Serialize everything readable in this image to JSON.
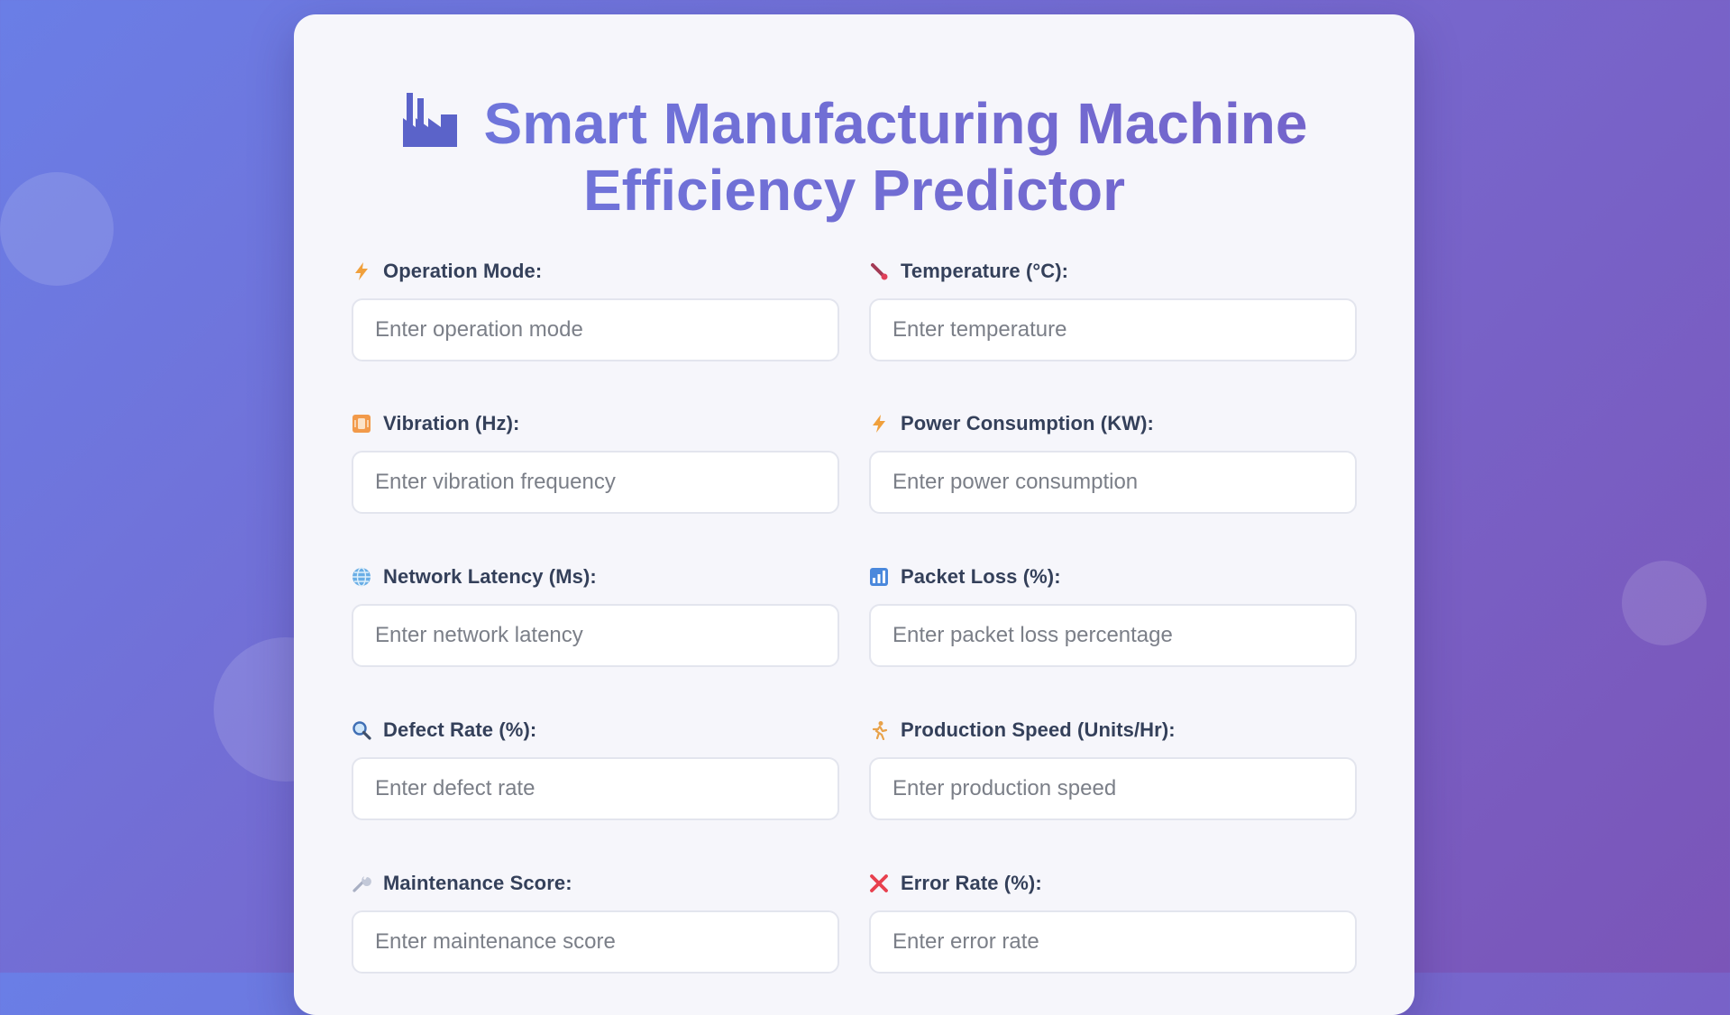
{
  "title": {
    "line1": "Smart Manufacturing Machine",
    "line2": "Efficiency Predictor",
    "icon": "factory-icon"
  },
  "colors": {
    "title_accent": "#7565cf",
    "label": "#34405a",
    "input_border": "#e3e5ee",
    "background_start": "#6a7ee6",
    "background_end": "#7b55b8"
  },
  "fields": [
    {
      "label": "Operation Mode:",
      "placeholder": "Enter operation mode",
      "icon": "lightning-icon"
    },
    {
      "label": "Temperature (°C):",
      "placeholder": "Enter temperature",
      "icon": "thermometer-icon"
    },
    {
      "label": "Vibration (Hz):",
      "placeholder": "Enter vibration frequency",
      "icon": "vibration-icon"
    },
    {
      "label": "Power Consumption (KW):",
      "placeholder": "Enter power consumption",
      "icon": "lightning-icon"
    },
    {
      "label": "Network Latency (Ms):",
      "placeholder": "Enter network latency",
      "icon": "globe-icon"
    },
    {
      "label": "Packet Loss (%):",
      "placeholder": "Enter packet loss percentage",
      "icon": "bar-chart-icon"
    },
    {
      "label": "Defect Rate (%):",
      "placeholder": "Enter defect rate",
      "icon": "magnifier-icon"
    },
    {
      "label": "Production Speed (Units/Hr):",
      "placeholder": "Enter production speed",
      "icon": "runner-icon"
    },
    {
      "label": "Maintenance Score:",
      "placeholder": "Enter maintenance score",
      "icon": "wrench-icon"
    },
    {
      "label": "Error Rate (%):",
      "placeholder": "Enter error rate",
      "icon": "cross-mark-icon"
    }
  ]
}
